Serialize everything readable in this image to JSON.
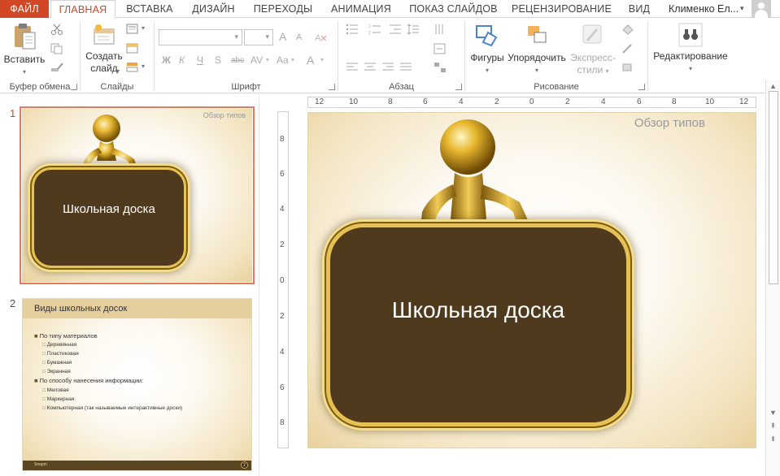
{
  "tabs": [
    {
      "label": "ФАЙЛ"
    },
    {
      "label": "ГЛАВНАЯ"
    },
    {
      "label": "ВСТАВКА"
    },
    {
      "label": "ДИЗАЙН"
    },
    {
      "label": "ПЕРЕХОДЫ"
    },
    {
      "label": "АНИМАЦИЯ"
    },
    {
      "label": "ПОКАЗ СЛАЙДОВ"
    },
    {
      "label": "РЕЦЕНЗИРОВАНИЕ"
    },
    {
      "label": "ВИД"
    }
  ],
  "user": {
    "name": "Клименко Ел..."
  },
  "ribbon": {
    "clipboard": {
      "label": "Буфер обмена",
      "paste": "Вставить"
    },
    "slides": {
      "label": "Слайды",
      "new_slide_1": "Создать",
      "new_slide_2": "слайд"
    },
    "font": {
      "label": "Шрифт",
      "bold": "Ж",
      "italic": "К",
      "underline": "Ч",
      "shadow": "S",
      "strike": "abc",
      "spacing": "AV",
      "case": "Aa",
      "grow": "A",
      "shrink": "A",
      "color": "A"
    },
    "paragraph": {
      "label": "Абзац"
    },
    "drawing": {
      "label": "Рисование",
      "shapes": "Фигуры",
      "arrange": "Упорядочить",
      "quick_styles_1": "Экспресс-",
      "quick_styles_2": "стили"
    },
    "editing": {
      "label": "Редактирование"
    }
  },
  "thumbnails": [
    {
      "number": "1",
      "corner": "Обзор типов",
      "title": "Школьная доска"
    },
    {
      "number": "2",
      "heading": "Виды школьных досок",
      "bullets": [
        {
          "level": 1,
          "text": "По типу материалов"
        },
        {
          "level": 2,
          "text": "Деревянная"
        },
        {
          "level": 2,
          "text": "Пластиковая"
        },
        {
          "level": 2,
          "text": "Бумажная"
        },
        {
          "level": 2,
          "text": "Экранная"
        },
        {
          "level": 1,
          "text": "По способу нанесения информации:"
        },
        {
          "level": 2,
          "text": "Меловая"
        },
        {
          "level": 2,
          "text": "Маркерная"
        },
        {
          "level": 2,
          "text": "Компьютерная (так называемые интерактивные доски)"
        }
      ],
      "footer_left": "Snapm",
      "footer_right": "2"
    }
  ],
  "main_slide": {
    "corner": "Обзор типов",
    "title": "Школьная доска"
  },
  "hruler": [
    "12",
    "10",
    "8",
    "6",
    "4",
    "2",
    "0",
    "2",
    "4",
    "6",
    "8",
    "10",
    "12"
  ],
  "vruler": [
    "8",
    "6",
    "4",
    "2",
    "0",
    "2",
    "4",
    "6",
    "8"
  ],
  "colors": {
    "accent": "#d24726",
    "board": "#4f3a1e",
    "frame": "#e6c255",
    "selection": "#e07b5e"
  }
}
